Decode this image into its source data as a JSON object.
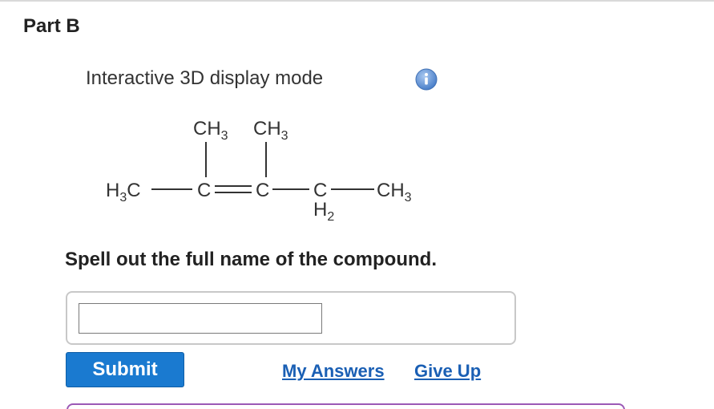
{
  "part": {
    "title": "Part B"
  },
  "display": {
    "mode_label": "Interactive 3D display mode",
    "info_icon": "info-icon"
  },
  "structure": {
    "sub1": "CH",
    "sub1_n": "3",
    "sub2": "CH",
    "sub2_n": "3",
    "left": "H",
    "left_n": "3",
    "left_c": "C",
    "c1": "C",
    "c2": "C",
    "c3": "C",
    "h2": "H",
    "h2_n": "2",
    "right": "CH",
    "right_n": "3"
  },
  "question": {
    "prompt": "Spell out the full name of the compound."
  },
  "answer": {
    "value": "",
    "placeholder": ""
  },
  "actions": {
    "submit_label": "Submit",
    "my_answers_label": "My Answers",
    "give_up_label": "Give Up"
  },
  "colors": {
    "submit_bg": "#1a7ad0",
    "link": "#1a5fb4",
    "info_icon": "#5b8fd6",
    "next_panel_border": "#9b59b6"
  }
}
